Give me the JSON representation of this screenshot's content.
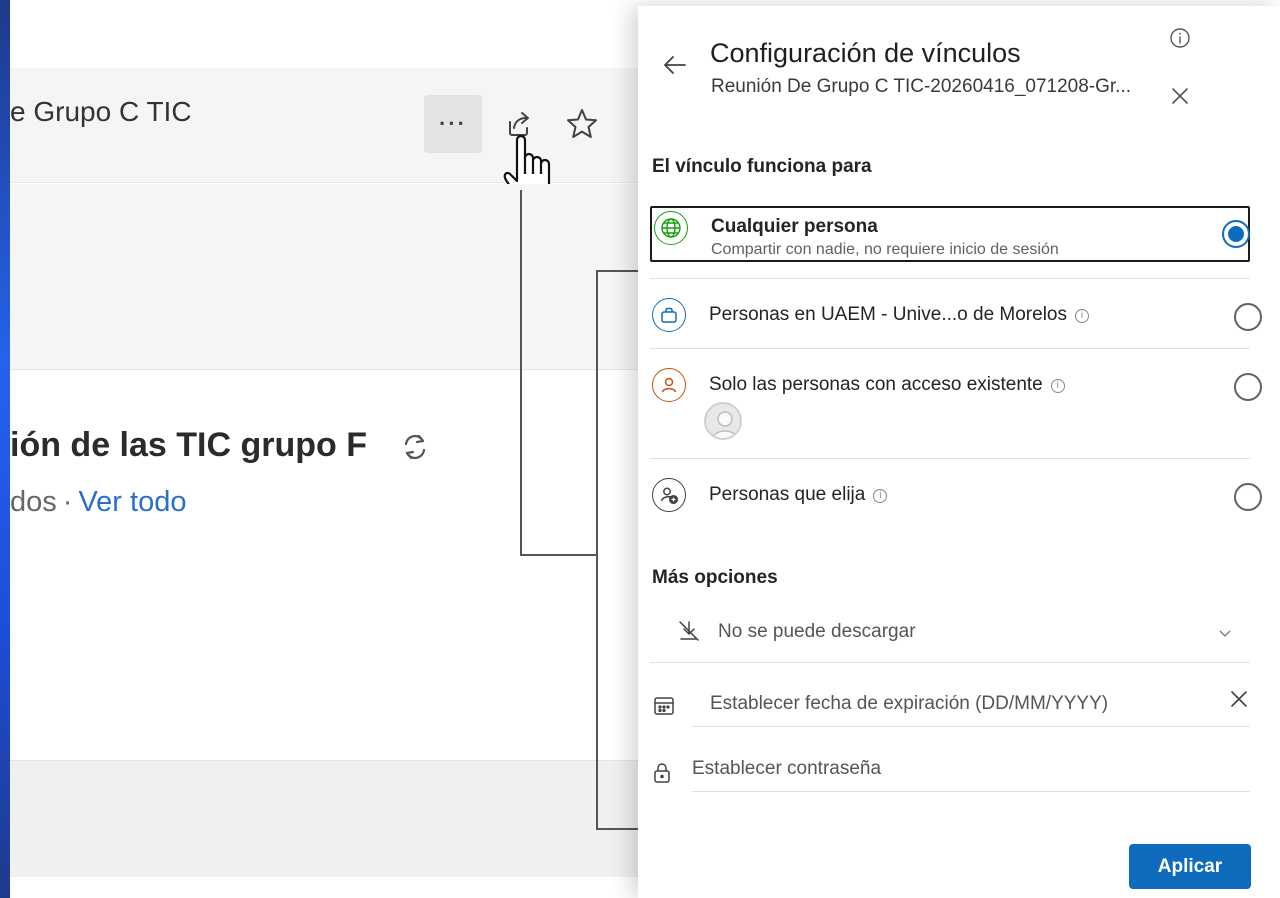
{
  "background": {
    "title": "e Grupo C TIC",
    "more_label": "···",
    "section_title": "ión de las TIC grupo F",
    "sub_prefix": "dos",
    "sub_dot": "·",
    "sub_link": "Ver todo"
  },
  "panel": {
    "title": "Configuración de vínculos",
    "subtitle": "Reunión De Grupo C TIC-20260416_071208-Gr...",
    "link_works_for_label": "El vínculo funciona para",
    "options": [
      {
        "label": "Cualquier persona",
        "description": "Compartir con nadie, no requiere inicio de sesión",
        "selected": true,
        "icon": "globe-icon",
        "color": "#13a10e"
      },
      {
        "label": "Personas en UAEM - Unive...o de Morelos",
        "selected": false,
        "icon": "briefcase-icon",
        "color": "#0f6cbd"
      },
      {
        "label": "Solo las personas con acceso existente",
        "selected": false,
        "icon": "person-icon",
        "color": "#ca5010"
      },
      {
        "label": "Personas que elija",
        "selected": false,
        "icon": "person-add-icon",
        "color": "#424242"
      }
    ],
    "more_options_label": "Más opciones",
    "download_setting": "No se puede descargar",
    "expiration_placeholder": "Establecer fecha de expiración (DD/MM/YYYY)",
    "password_placeholder": "Establecer contraseña",
    "apply_label": "Aplicar"
  },
  "colors": {
    "accent": "#0f6cbd",
    "link": "#2a6fc9"
  }
}
